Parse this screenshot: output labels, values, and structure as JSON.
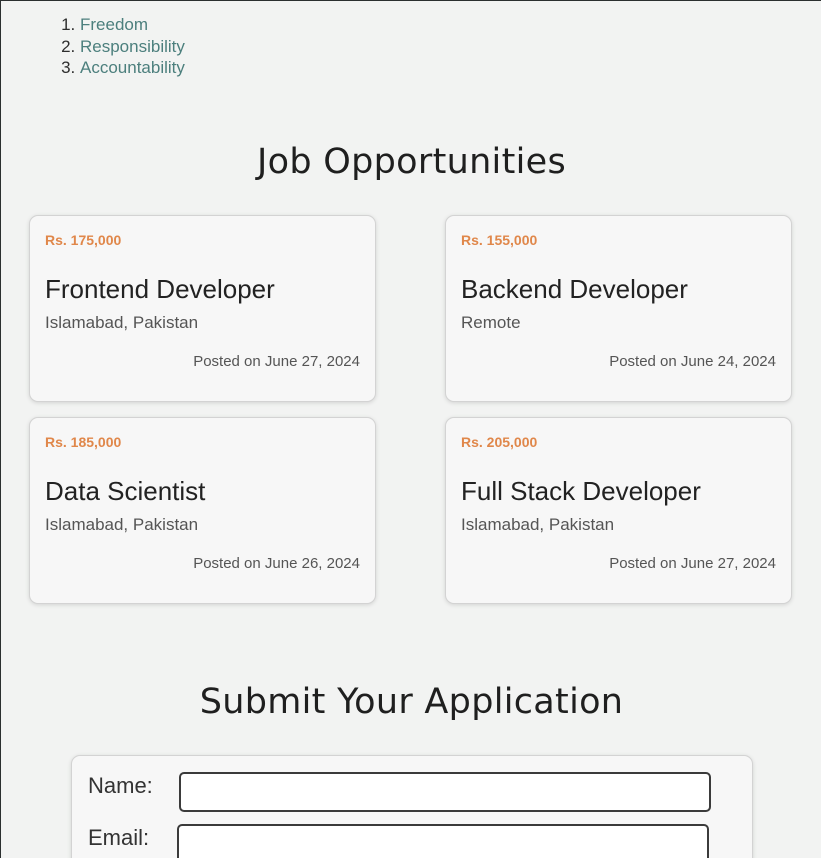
{
  "values": [
    "Freedom",
    "Responsibility",
    "Accountability"
  ],
  "jobs_section": {
    "title": "Job Opportunities",
    "jobs": [
      {
        "salary": "Rs. 175,000",
        "title": "Frontend Developer",
        "location": "Islamabad, Pakistan",
        "posted": "Posted on June 27, 2024"
      },
      {
        "salary": "Rs. 155,000",
        "title": "Backend Developer",
        "location": "Remote",
        "posted": "Posted on June 24, 2024"
      },
      {
        "salary": "Rs. 185,000",
        "title": "Data Scientist",
        "location": "Islamabad, Pakistan",
        "posted": "Posted on June 26, 2024"
      },
      {
        "salary": "Rs. 205,000",
        "title": "Full Stack Developer",
        "location": "Islamabad, Pakistan",
        "posted": "Posted on June 27, 2024"
      }
    ]
  },
  "application": {
    "title": "Submit Your Application",
    "name_label": "Name:",
    "name_value": "",
    "email_label": "Email:",
    "email_value": ""
  },
  "colors": {
    "background": "#f2f3f2",
    "link": "#4c7f7d",
    "salary": "#e0874a"
  }
}
